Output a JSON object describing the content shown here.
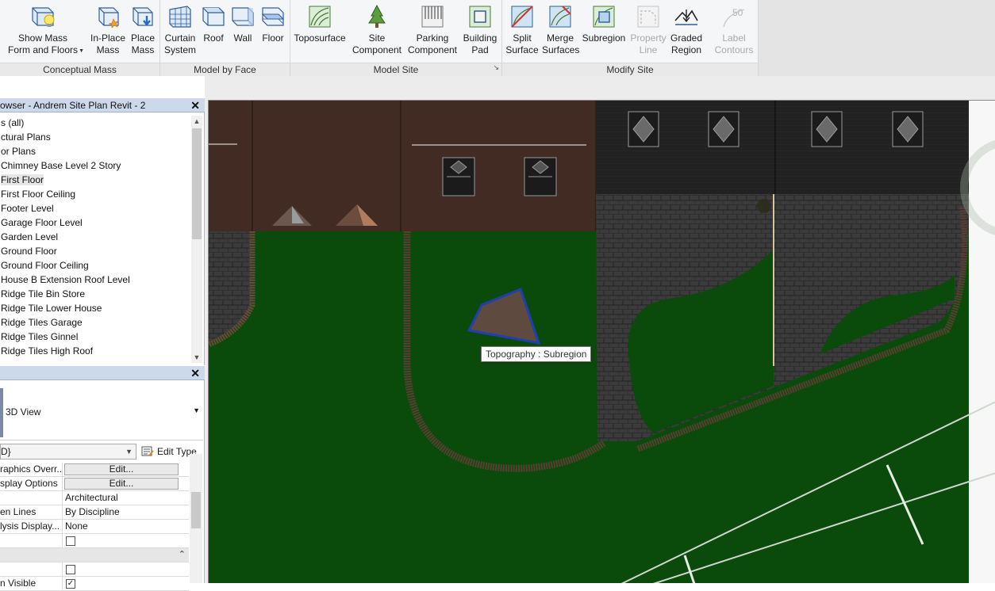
{
  "ribbon": {
    "panels": [
      {
        "title": "Conceptual Mass"
      },
      {
        "title": "Model by Face"
      },
      {
        "title": "Model Site",
        "launcher": "↘"
      },
      {
        "title": "Modify Site"
      }
    ],
    "buttons": {
      "show_mass": {
        "line1": "Show Mass",
        "line2": "Form and Floors"
      },
      "inplace_mass": {
        "line1": "In-Place",
        "line2": "Mass"
      },
      "place_mass": {
        "line1": "Place",
        "line2": "Mass"
      },
      "curtain_system": {
        "line1": "Curtain",
        "line2": "System"
      },
      "roof": {
        "line1": "Roof"
      },
      "wall": {
        "line1": "Wall"
      },
      "floor": {
        "line1": "Floor"
      },
      "toposurface": {
        "line1": "Toposurface"
      },
      "site_component": {
        "line1": "Site",
        "line2": "Component"
      },
      "parking_component": {
        "line1": "Parking",
        "line2": "Component"
      },
      "building_pad": {
        "line1": "Building",
        "line2": "Pad"
      },
      "split_surface": {
        "line1": "Split",
        "line2": "Surface"
      },
      "merge_surfaces": {
        "line1": "Merge",
        "line2": "Surfaces"
      },
      "subregion": {
        "line1": "Subregion"
      },
      "property_line": {
        "line1": "Property",
        "line2": "Line"
      },
      "graded_region": {
        "line1": "Graded",
        "line2": "Region"
      },
      "label_contours": {
        "line1": "Label",
        "line2": "Contours",
        "icon_text": "50"
      }
    }
  },
  "project_browser": {
    "title": "owser - Andrem Site Plan Revit - 2",
    "close": "✕",
    "items": [
      "s (all)",
      "ctural Plans",
      "or Plans",
      "Chimney Base Level 2 Story",
      "First Floor",
      "First Floor Ceiling",
      "Footer Level",
      "Garage Floor Level",
      "Garden Level",
      "Ground Floor",
      "Ground Floor Ceiling",
      "House B Extension Roof Level",
      "Ridge Tile Bin Store",
      "Ridge Tile Lower House",
      "Ridge Tiles Garage",
      "Ridge Tiles Ginnel",
      "Ridge Tiles High Roof"
    ],
    "selected_index": 4
  },
  "properties": {
    "close": "✕",
    "type_name": "3D View",
    "instance_value": "D}",
    "edit_type_label": "Edit Type",
    "rows": [
      {
        "name": "raphics Overr...",
        "button": "Edit..."
      },
      {
        "name": "splay Options",
        "button": "Edit..."
      },
      {
        "name": "",
        "value": "Architectural"
      },
      {
        "name": "en Lines",
        "value": "By Discipline"
      },
      {
        "name": "lysis Display...",
        "value": "None"
      },
      {
        "name": "",
        "checkbox": "unchecked"
      },
      {
        "group": true,
        "collapse": "⌃"
      },
      {
        "name": "",
        "checkbox": "unchecked"
      },
      {
        "name": "n Visible",
        "checkbox": "checked"
      }
    ]
  },
  "view": {
    "tooltip": "Topography : Subregion",
    "colors": {
      "grass": "#0a4a0a",
      "building": "#412b22",
      "paving": "#3a3a3a",
      "subregion_fill": "#5e4a3f",
      "subregion_outline": "#1f3fae",
      "brick_edge": "#6b4a3a"
    }
  }
}
